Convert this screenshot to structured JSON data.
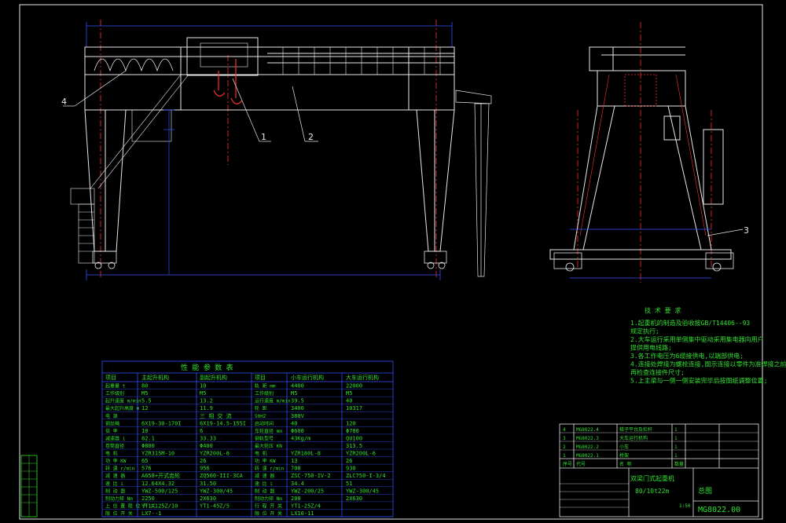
{
  "callouts": [
    "1",
    "2",
    "3",
    "4"
  ],
  "tech_requirements": {
    "title": "技 术 要 求",
    "items": [
      "1.起重机的制造及验收按GB/T14406--93",
      "  规定执行;",
      "2.大车运行采用单侧集中驱动采用集电器向用户",
      "  提供用电线路;",
      "3.各工作电压为6缆接供电,以端部供电;",
      "4.连接处焊接为螺栓连接,图示连接以零件为准焊接之前,",
      "  再检查连接件尺寸;",
      "5.上主梁与一侧一侧安装完毕后按图纸调整位置;"
    ]
  },
  "perf_table": {
    "title": "性    能    参    数    表",
    "headers": [
      "项目",
      "主起升机构",
      "副起升机构",
      "项目",
      "小车运行机构",
      "大车运行机构"
    ],
    "rows": [
      [
        "起重量 t",
        "80",
        "10",
        "轨 距 mm",
        "4400",
        "22000"
      ],
      [
        "工作级别",
        "M5",
        "M5",
        "工作级别",
        "M5",
        "M5"
      ],
      [
        "起升速度 m/min",
        "5.5",
        "13.2",
        "运行速度 m/min",
        "39.5",
        "40"
      ],
      [
        "最大起升高度 m",
        "12",
        "11.9",
        "轮 距",
        "3400",
        "10317"
      ],
      [
        "电 源",
        "",
        "三 相 交 流",
        "50HZ",
        "380V",
        ""
      ],
      [
        "钢丝绳",
        "6X19-30-170I",
        "6X19-14.5-155I",
        "启动时间",
        "40",
        "120"
      ],
      [
        "倍 率",
        "10",
        "6",
        "车轮直径 mm",
        "Φ600",
        "Φ700"
      ],
      [
        "减速器 i",
        "82.1",
        "33.33",
        "钢轨型号",
        "43Kg/m",
        "QU100"
      ],
      [
        "卷筒直径",
        "Φ800",
        "Φ400",
        "最大轮压 KN",
        "",
        "313.5"
      ],
      [
        "电 机",
        "YZR315M-10",
        "YZR200L-6",
        "电 机",
        "YZR180L-8",
        "YZR200L-6"
      ],
      [
        "功 率 KW",
        "65",
        "26",
        "功 率 KW",
        "13",
        "26"
      ],
      [
        "转 速 r/min",
        "576",
        "956",
        "转 速 r/min",
        "708",
        "930"
      ],
      [
        "减 速 器",
        "A658+开式齿轮",
        "ZQ500-III-3CA",
        "减 速 器",
        "ZSC-750-IV-2",
        "ZLC750-I-3/4"
      ],
      [
        "速 比 i",
        "12.64X4.32",
        "31.50",
        "速 比 i",
        "34.4",
        "51"
      ],
      [
        "制 动 器",
        "YWZ-500/125",
        "YWZ-300/45",
        "制 动 器",
        "YWZ-200/25",
        "YWZ-300/45"
      ],
      [
        "制动力矩 Nm",
        "2250",
        "2X630",
        "制动力矩 Nm",
        "200",
        "2X630"
      ],
      [
        "上 位 置 限 位 开 关",
        "YT1-125Z/10",
        "YT1-45Z/5",
        "行 程 开 关",
        "YT1-25Z/4",
        ""
      ],
      [
        "限 位 开 关",
        "LX7--1",
        "",
        "限 位 开 关",
        "LX10-11",
        ""
      ]
    ]
  },
  "bom": {
    "rows": [
      [
        "4",
        "MG8022.4",
        "梯子平台及栏杆",
        "1"
      ],
      [
        "3",
        "MG8022.3",
        "大车运行机构",
        "1"
      ],
      [
        "2",
        "MG8022.2",
        "小车",
        "1"
      ],
      [
        "1",
        "MG8022.1",
        "桥架",
        "1"
      ]
    ],
    "headers": [
      "序号",
      "代号",
      "名 称",
      "数量"
    ]
  },
  "title_block": {
    "name": "双梁门式起重机",
    "spec": "80/10t22m",
    "drawing_type": "总图",
    "drawing_no": "MG8022.00",
    "scale": "1:50"
  }
}
